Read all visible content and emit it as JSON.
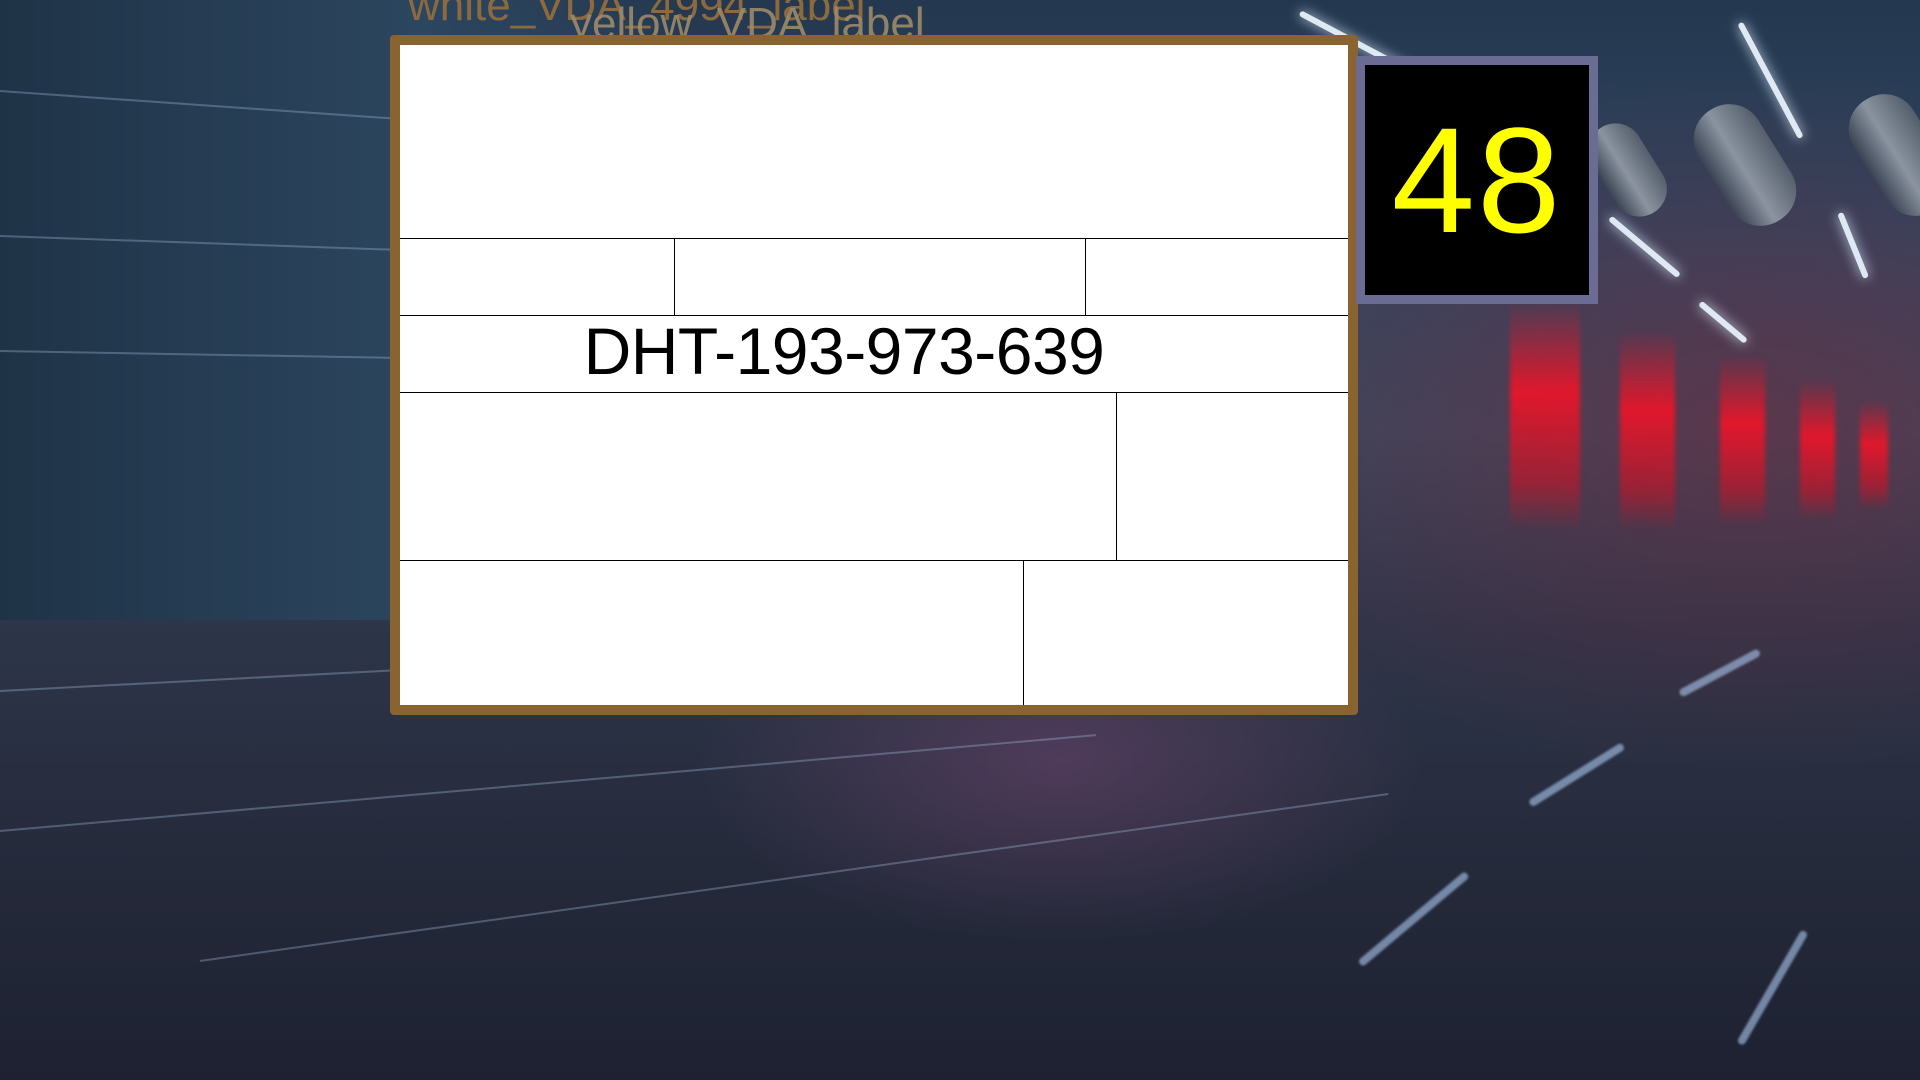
{
  "overlay_labels": {
    "white_label": "white_VDA_4994_label",
    "yellow_label": "yellow_VDA_label"
  },
  "label_card": {
    "code": "DHT-193-973-639"
  },
  "number_badge": {
    "value": "48",
    "text_color": "#ffff00",
    "background": "#000000",
    "border_color": "#6a6c93"
  },
  "colors": {
    "card_border": "#8a6430",
    "card_background": "#ffffff"
  }
}
